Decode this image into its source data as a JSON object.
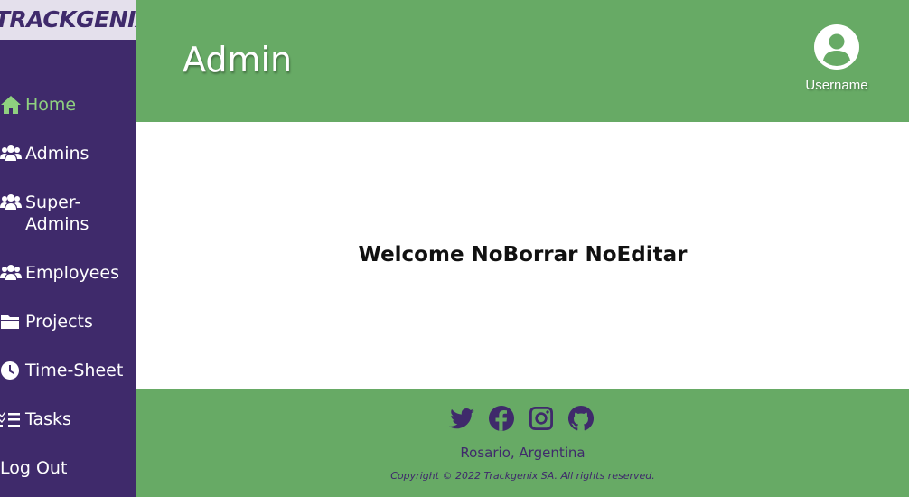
{
  "brand": {
    "logo_text": "TRACKGENIX"
  },
  "sidebar": {
    "items": [
      {
        "label": "Home",
        "icon": "home-icon",
        "active": true
      },
      {
        "label": "Admins",
        "icon": "users-icon"
      },
      {
        "label": "Super-Admins",
        "icon": "users-icon"
      },
      {
        "label": "Employees",
        "icon": "users-icon"
      },
      {
        "label": "Projects",
        "icon": "folder-icon"
      },
      {
        "label": "Time-Sheet",
        "icon": "clock-icon"
      },
      {
        "label": "Tasks",
        "icon": "tasks-icon"
      },
      {
        "label": "Log Out"
      }
    ]
  },
  "header": {
    "title": "Admin",
    "username": "Username",
    "avatar_icon": "user-circle-icon"
  },
  "main": {
    "welcome": "Welcome NoBorrar NoEditar"
  },
  "footer": {
    "social": [
      "twitter-icon",
      "facebook-icon",
      "instagram-icon",
      "github-icon"
    ],
    "location": "Rosario, Argentina",
    "copyright": "Copyright © 2022 Trackgenix SA. All rights reserved."
  },
  "colors": {
    "sidebar": "#3f2a6b",
    "header": "#67aa65",
    "active_link": "#8fd17f",
    "logo_bg": "#e4e0ec"
  }
}
